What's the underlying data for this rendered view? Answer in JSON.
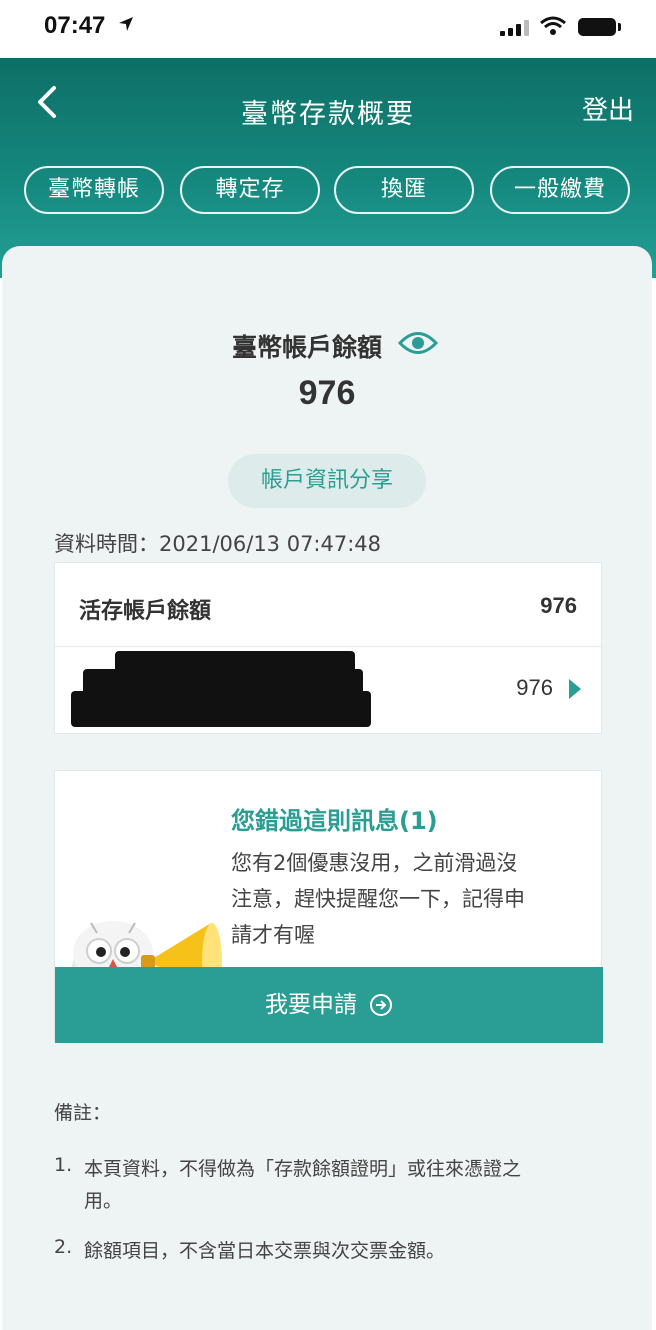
{
  "status_bar": {
    "time": "07:47"
  },
  "header": {
    "title": "臺幣存款概要",
    "logout_label": "登出",
    "quick_actions": [
      "臺幣轉帳",
      "轉定存",
      "換匯",
      "一般繳費"
    ]
  },
  "balance": {
    "title": "臺幣帳戶餘額",
    "value": "976",
    "share_label": "帳戶資訊分享",
    "data_time": "資料時間：2021/06/13 07:47:48"
  },
  "accounts": {
    "header_label": "活存帳戶餘額",
    "header_value": "976",
    "row_value": "976"
  },
  "promo": {
    "title": "您錯過這則訊息(1)",
    "body_lines": [
      "您有2個優惠沒用，之前滑過沒",
      "注意，趕快提醒您一下，記得申",
      "請才有喔"
    ],
    "button_label": "我要申請"
  },
  "notes": {
    "title": "備註：",
    "items": [
      {
        "num": "1.",
        "lines": [
          "本頁資料，不得做為「存款餘額證明」或往來憑證之",
          "用。"
        ]
      },
      {
        "num": "2.",
        "lines": [
          "餘額項目，不含當日本交票與次交票金額。"
        ]
      }
    ]
  },
  "colors": {
    "brand_teal": "#2a9d94",
    "header_dark": "#0e6f66"
  }
}
